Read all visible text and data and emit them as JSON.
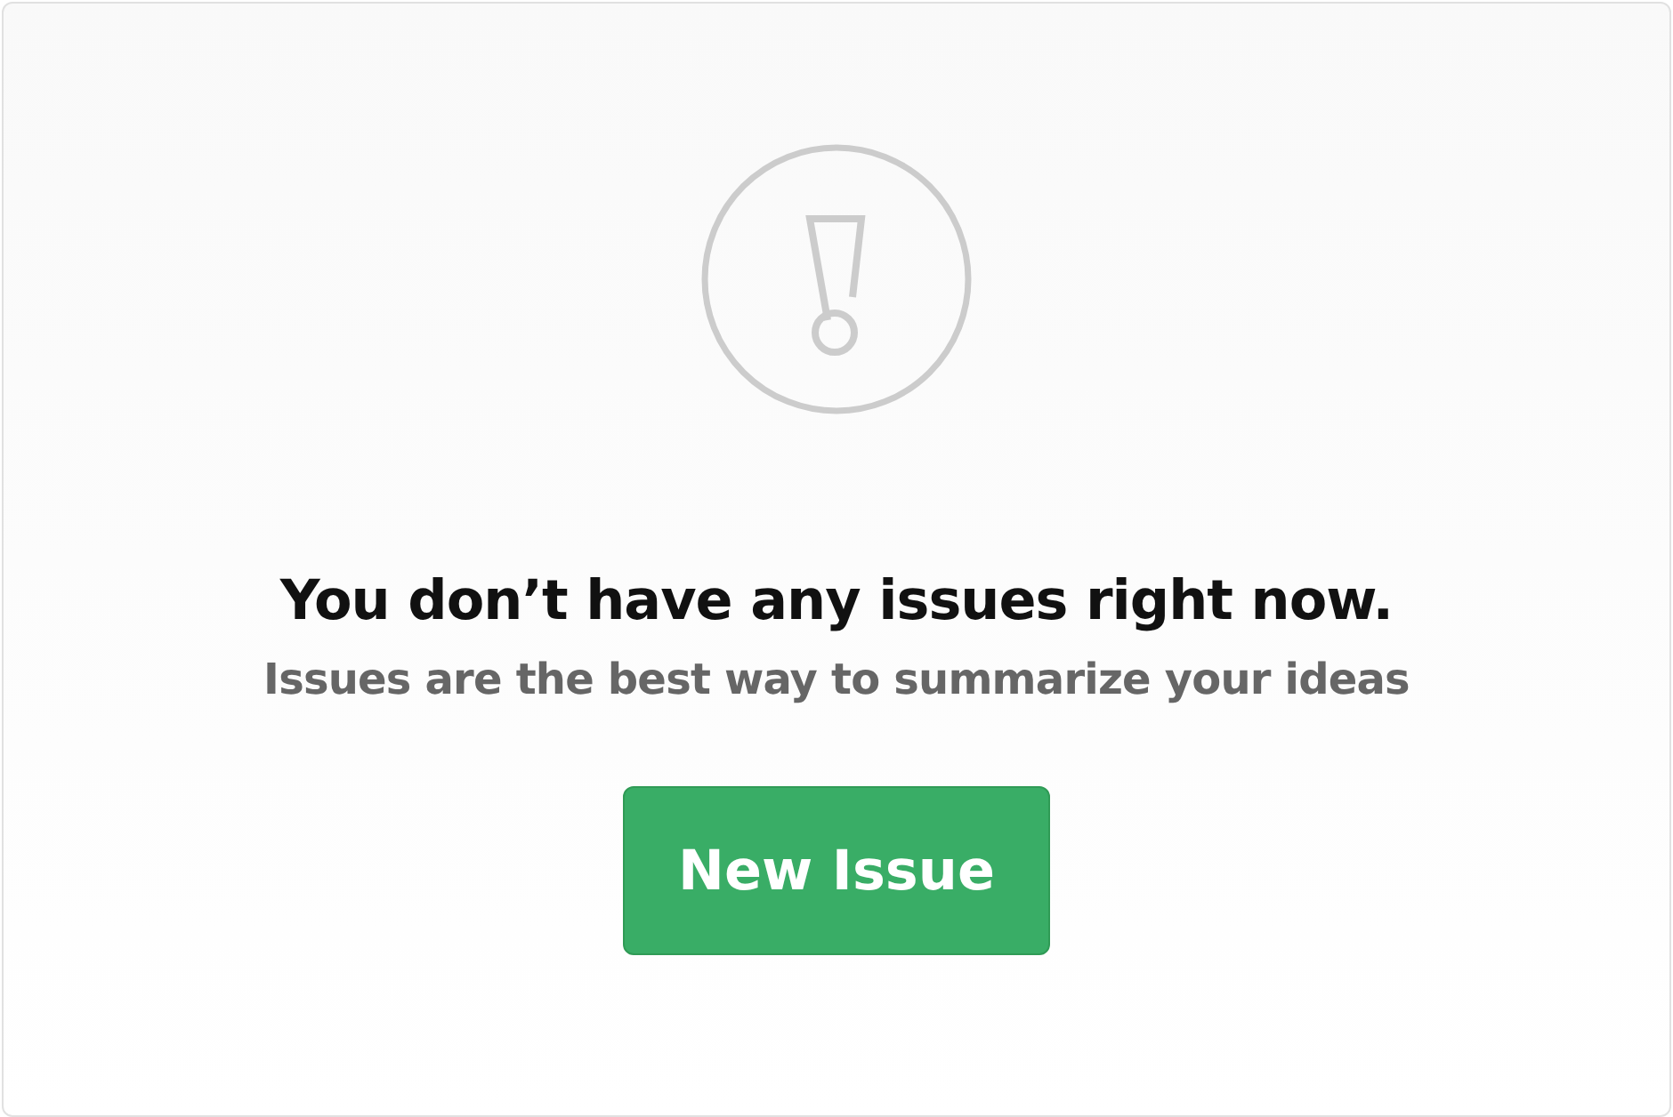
{
  "blankslate": {
    "title": "You don’t have any issues right now.",
    "description": "Issues are the best way to summarize your ideas",
    "button": "New Issue"
  }
}
